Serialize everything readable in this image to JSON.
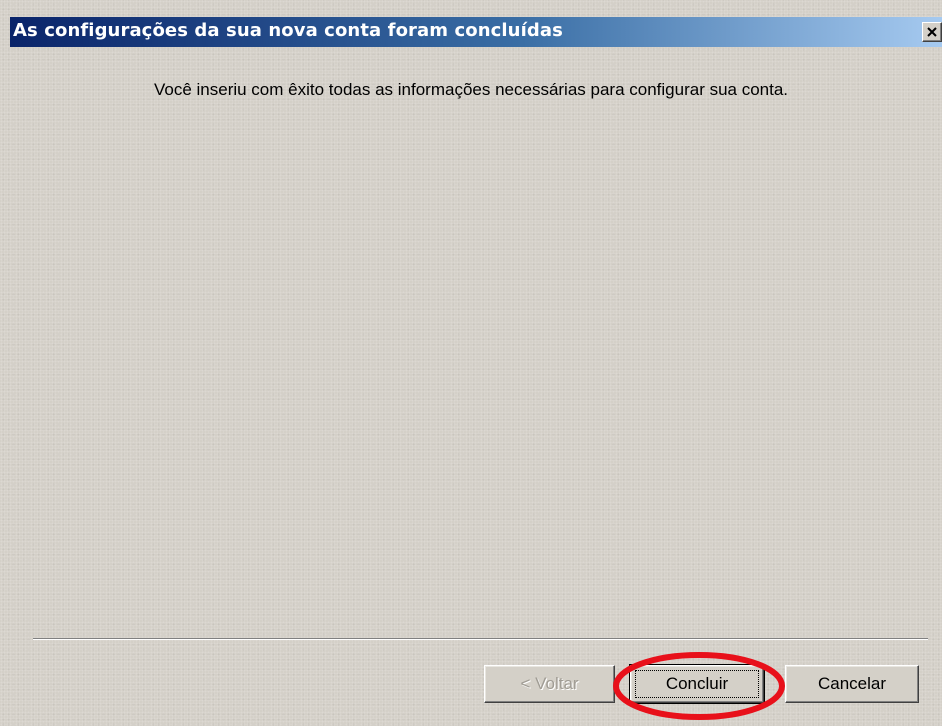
{
  "window": {
    "title": "As configurações da sua nova conta foram concluídas",
    "close_icon": "close-icon"
  },
  "content": {
    "message": "Você inseriu com êxito todas as informações necessárias para configurar sua conta."
  },
  "buttons": {
    "back_label": "< Voltar",
    "back_enabled": false,
    "finish_label": "Concluir",
    "cancel_label": "Cancelar"
  },
  "annotation": {
    "shape": "ellipse",
    "target": "Concluir",
    "color": "#e8101a"
  },
  "colors": {
    "dialog_face": "#d4d0c8",
    "titlebar_start": "#0a246a",
    "titlebar_end": "#a6caf0"
  }
}
